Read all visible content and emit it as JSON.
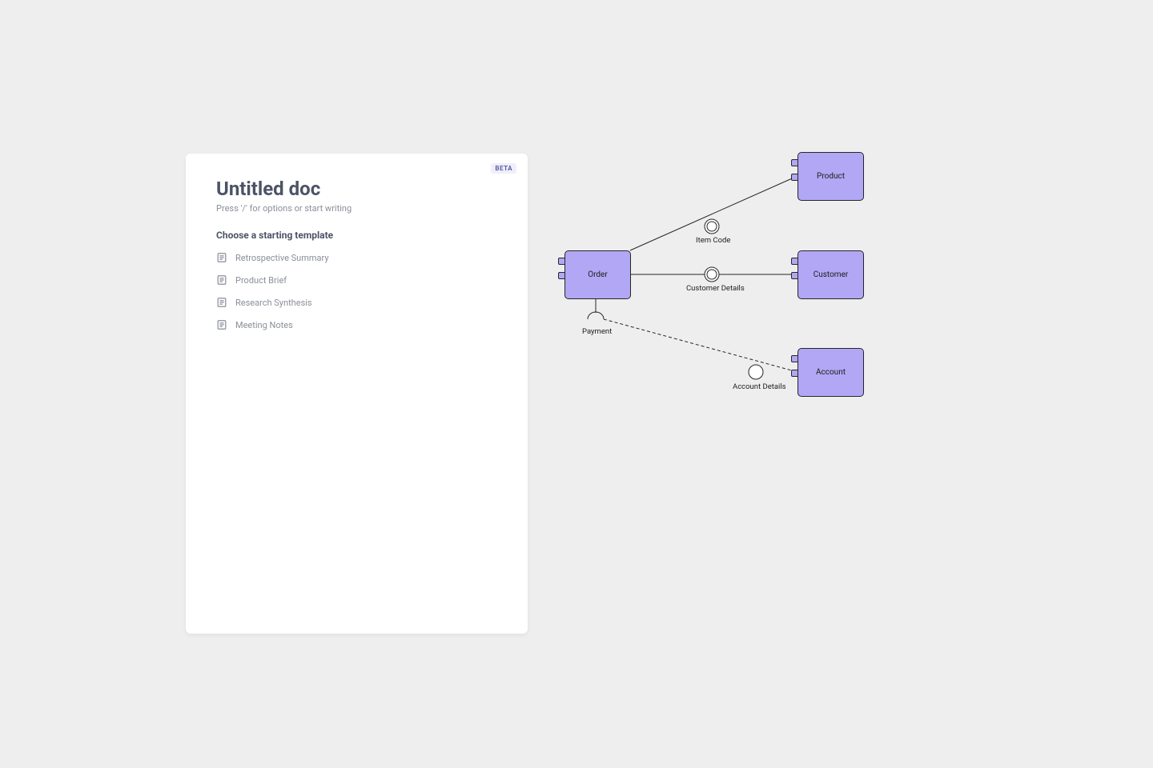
{
  "doc": {
    "badge": "BETA",
    "title": "Untitled doc",
    "hint": "Press '/' for options or start writing",
    "template_heading": "Choose a starting template",
    "templates": [
      {
        "label": "Retrospective Summary"
      },
      {
        "label": "Product Brief"
      },
      {
        "label": "Research Synthesis"
      },
      {
        "label": "Meeting Notes"
      }
    ]
  },
  "diagram": {
    "nodes": {
      "order": {
        "label": "Order"
      },
      "product": {
        "label": "Product"
      },
      "customer": {
        "label": "Customer"
      },
      "account": {
        "label": "Account"
      }
    },
    "edges": {
      "item_code": {
        "label": "Item Code"
      },
      "customer_details": {
        "label": "Customer Details"
      },
      "payment": {
        "label": "Payment"
      },
      "account_details": {
        "label": "Account Details"
      }
    }
  }
}
